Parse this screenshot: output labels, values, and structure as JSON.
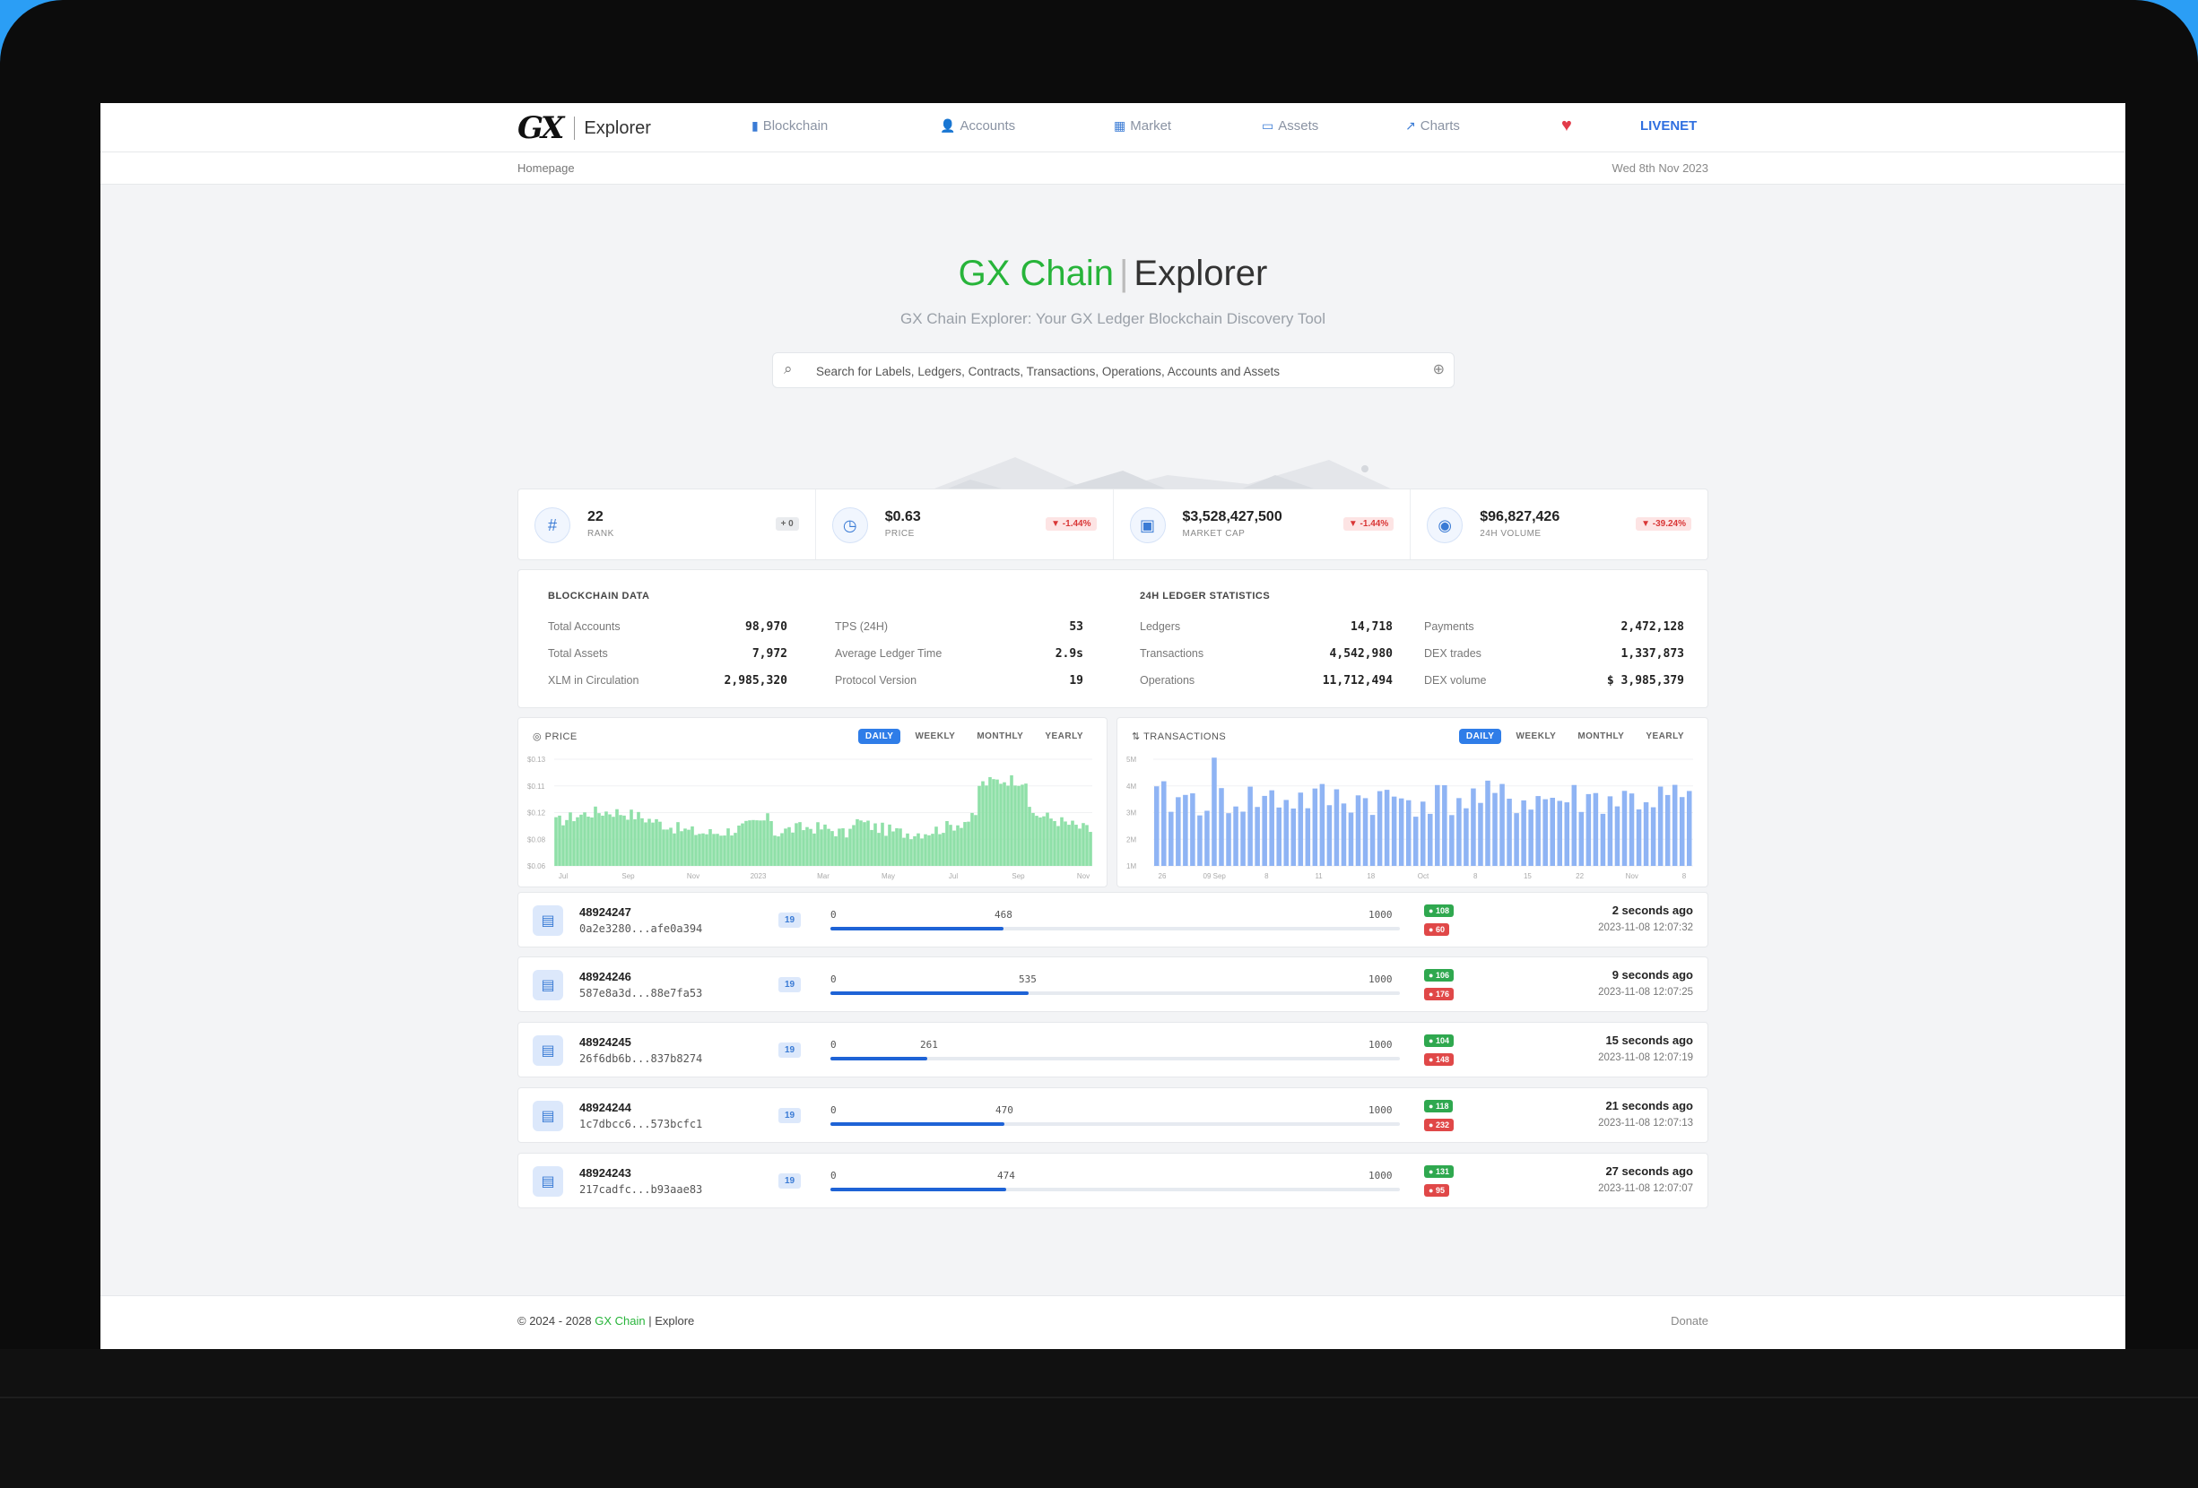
{
  "brand": {
    "logo": "GX",
    "name": "Explorer"
  },
  "nav": [
    {
      "label": "Blockchain",
      "icon": "bar-chart-icon"
    },
    {
      "label": "Accounts",
      "icon": "users-icon"
    },
    {
      "label": "Market",
      "icon": "calendar-icon"
    },
    {
      "label": "Assets",
      "icon": "wallet-icon"
    },
    {
      "label": "Charts",
      "icon": "line-chart-icon"
    }
  ],
  "live_label": "LIVENET",
  "breadcrumb": "Homepage",
  "date": "Wed 8th Nov 2023",
  "hero": {
    "title_green": "GX Chain",
    "title_rest": "Explorer",
    "subtitle": "GX Chain Explorer: Your GX Ledger Blockchain Discovery Tool"
  },
  "search": {
    "placeholder": "Search for Labels, Ledgers, Contracts, Transactions, Operations, Accounts and Assets"
  },
  "stats": [
    {
      "value": "22",
      "label": "RANK",
      "badge": "+ 0",
      "badge_type": "gray",
      "icon": "hash-icon"
    },
    {
      "value": "$0.63",
      "label": "PRICE",
      "badge": "▼ -1.44%",
      "badge_type": "red",
      "icon": "clock-icon"
    },
    {
      "value": "$3,528,427,500",
      "label": "MARKET CAP",
      "badge": "▼ -1.44%",
      "badge_type": "red",
      "icon": "wallet-icon"
    },
    {
      "value": "$96,827,426",
      "label": "24H VOLUME",
      "badge": "▼ -39.24%",
      "badge_type": "red",
      "icon": "coins-icon"
    }
  ],
  "blockchain_data": {
    "heading": "BLOCKCHAIN DATA",
    "rows": [
      {
        "label": "Total Accounts",
        "value": "98,970"
      },
      {
        "label": "Total Assets",
        "value": "7,972"
      },
      {
        "label": "XLM in Circulation",
        "value": "2,985,320"
      }
    ],
    "rows2": [
      {
        "label": "TPS (24H)",
        "value": "53"
      },
      {
        "label": "Average Ledger Time",
        "value": "2.9s"
      },
      {
        "label": "Protocol Version",
        "value": "19"
      }
    ]
  },
  "ledger_stats": {
    "heading": "24H LEDGER STATISTICS",
    "rows": [
      {
        "label": "Ledgers",
        "value": "14,718"
      },
      {
        "label": "Transactions",
        "value": "4,542,980"
      },
      {
        "label": "Operations",
        "value": "11,712,494"
      }
    ],
    "rows2": [
      {
        "label": "Payments",
        "value": "2,472,128"
      },
      {
        "label": "DEX trades",
        "value": "1,337,873"
      },
      {
        "label": "DEX volume",
        "value": "$ 3,985,379"
      }
    ]
  },
  "price_chart": {
    "title": "PRICE",
    "tabs": [
      "DAILY",
      "WEEKLY",
      "MONTHLY",
      "YEARLY"
    ],
    "active_tab": "DAILY",
    "y_ticks": [
      "$0.13",
      "$0.11",
      "$0.12",
      "$0.08",
      "$0.06"
    ],
    "x_ticks": [
      "Jul",
      "Sep",
      "Nov",
      "2023",
      "Mar",
      "May",
      "Jul",
      "Sep",
      "Nov"
    ],
    "color": "#8fe0a8"
  },
  "tx_chart": {
    "title": "TRANSACTIONS",
    "tabs": [
      "DAILY",
      "WEEKLY",
      "MONTHLY",
      "YEARLY"
    ],
    "active_tab": "DAILY",
    "y_ticks": [
      "5M",
      "4M",
      "3M",
      "2M",
      "1M"
    ],
    "x_ticks": [
      "26",
      "09 Sep",
      "8",
      "11",
      "18",
      "Oct",
      "8",
      "15",
      "22",
      "Nov",
      "8"
    ],
    "color": "#8fb4f4"
  },
  "ledgers": [
    {
      "number": "48924247",
      "hash": "0a2e3280...afe0a394",
      "protocol": "19",
      "ops": "468",
      "ops_frac": 0.468,
      "max": "1000",
      "ok": "108",
      "fail": "60",
      "ago": "2 seconds ago",
      "time": "2023-11-08 12:07:32"
    },
    {
      "number": "48924246",
      "hash": "587e8a3d...88e7fa53",
      "protocol": "19",
      "ops": "535",
      "ops_frac": 0.535,
      "max": "1000",
      "ok": "106",
      "fail": "176",
      "ago": "9 seconds ago",
      "time": "2023-11-08 12:07:25"
    },
    {
      "number": "48924245",
      "hash": "26f6db6b...837b8274",
      "protocol": "19",
      "ops": "261",
      "ops_frac": 0.261,
      "max": "1000",
      "ok": "104",
      "fail": "148",
      "ago": "15 seconds ago",
      "time": "2023-11-08 12:07:19"
    },
    {
      "number": "48924244",
      "hash": "1c7dbcc6...573bcfc1",
      "protocol": "19",
      "ops": "470",
      "ops_frac": 0.47,
      "max": "1000",
      "ok": "118",
      "fail": "232",
      "ago": "21 seconds ago",
      "time": "2023-11-08 12:07:13"
    },
    {
      "number": "48924243",
      "hash": "217cadfc...b93aae83",
      "protocol": "19",
      "ops": "474",
      "ops_frac": 0.474,
      "max": "1000",
      "ok": "131",
      "fail": "95",
      "ago": "27 seconds ago",
      "time": "2023-11-08 12:07:07"
    }
  ],
  "footer": {
    "copyright": "© 2024 - 2028",
    "brand": "GX Chain",
    "suffix": "| Explore",
    "donate": "Donate"
  }
}
